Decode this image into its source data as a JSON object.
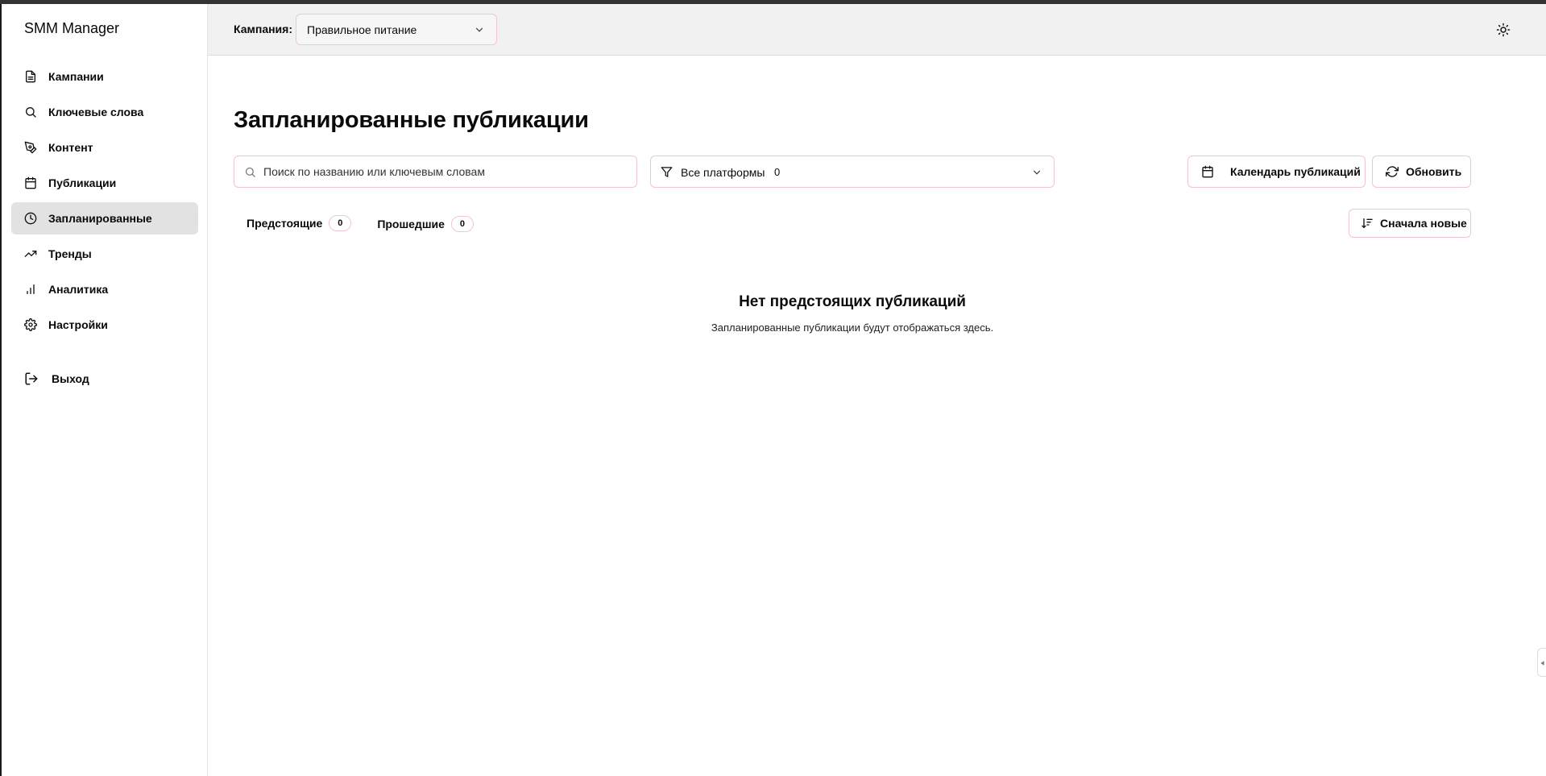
{
  "app": {
    "title": "SMM Manager"
  },
  "sidebar": {
    "items": [
      {
        "label": "Кампании",
        "icon": "file-icon",
        "active": false
      },
      {
        "label": "Ключевые слова",
        "icon": "search-icon",
        "active": false
      },
      {
        "label": "Контент",
        "icon": "pen-icon",
        "active": false
      },
      {
        "label": "Публикации",
        "icon": "calendar-icon",
        "active": false
      },
      {
        "label": "Запланированные",
        "icon": "clock-icon",
        "active": true
      },
      {
        "label": "Тренды",
        "icon": "trending-up-icon",
        "active": false
      },
      {
        "label": "Аналитика",
        "icon": "bar-chart-icon",
        "active": false
      },
      {
        "label": "Настройки",
        "icon": "gear-icon",
        "active": false
      }
    ],
    "logout_label": "Выход"
  },
  "header": {
    "campaign_label": "Кампания:",
    "campaign_value": "Правильное питание",
    "theme_icon": "sun-icon"
  },
  "main": {
    "title": "Запланированные публикации",
    "search_placeholder": "Поиск по названию или ключевым словам",
    "platform_filter_label": "Все платформы",
    "platform_filter_count": "0",
    "calendar_button_label": "Календарь публикаций",
    "refresh_button_label": "Обновить",
    "sort_button_label": "Сначала новые",
    "tabs": [
      {
        "label": "Предстоящие",
        "count": "0"
      },
      {
        "label": "Прошедшие",
        "count": "0"
      }
    ],
    "empty_title": "Нет предстоящих публикаций",
    "empty_subtitle": "Запланированные публикации будут отображаться здесь."
  },
  "colors": {
    "active_nav_bg": "#e2e2e2",
    "header_bg": "#f1f1f1",
    "accent_border": "#f0c6cf"
  }
}
